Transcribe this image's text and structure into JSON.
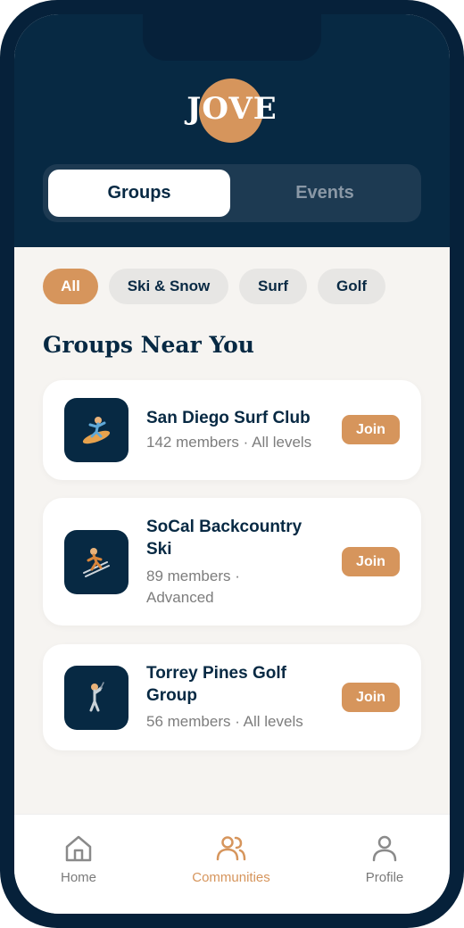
{
  "app": {
    "logo_text": "JOVE"
  },
  "segmented": {
    "tabs": [
      "Groups",
      "Events"
    ],
    "active": "Groups"
  },
  "filters": {
    "chips": [
      "All",
      "Ski & Snow",
      "Surf",
      "Golf"
    ],
    "active": "All"
  },
  "section": {
    "title": "Groups Near You"
  },
  "groups": [
    {
      "name": "San Diego Surf Club",
      "meta": "142 members · All levels",
      "icon": "surfer-icon",
      "join_label": "Join"
    },
    {
      "name": "SoCal Backcountry Ski",
      "meta": "89 members · Advanced",
      "icon": "skier-icon",
      "join_label": "Join"
    },
    {
      "name": "Torrey Pines Golf Group",
      "meta": "56 members · All levels",
      "icon": "golfer-icon",
      "join_label": "Join"
    }
  ],
  "tabbar": {
    "items": [
      {
        "label": "Home",
        "icon": "home-icon"
      },
      {
        "label": "Communities",
        "icon": "users-icon"
      },
      {
        "label": "Profile",
        "icon": "user-icon"
      }
    ],
    "active": "Communities"
  },
  "colors": {
    "navy": "#072943",
    "accent": "#d6955c",
    "background": "#f6f4f1",
    "muted": "#7d7d7d"
  }
}
